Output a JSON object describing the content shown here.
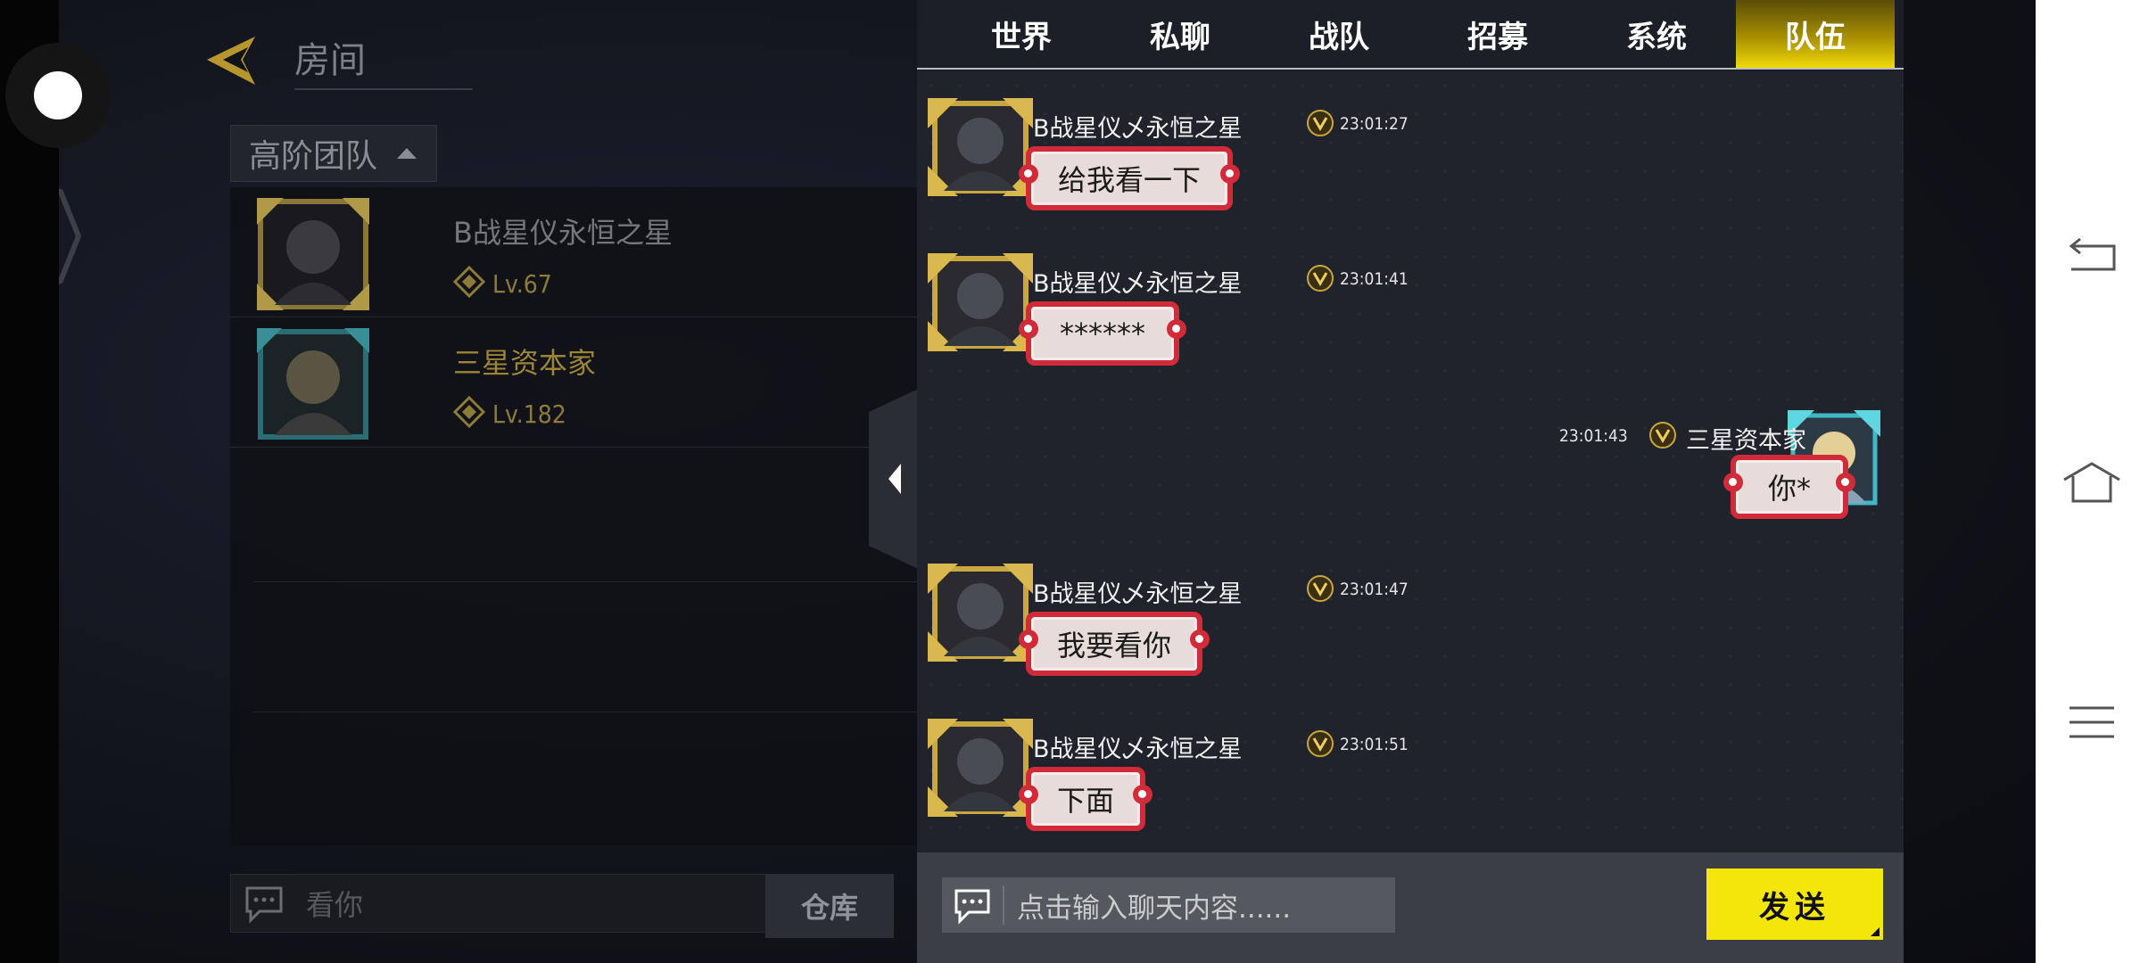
{
  "room": {
    "title": "房间",
    "team_tab": "高阶团队",
    "members": [
      {
        "name": "B战星仪永恒之星",
        "level": "Lv.67"
      },
      {
        "name": "三星资本家",
        "level": "Lv.182"
      }
    ],
    "input_text": "看你",
    "warehouse_label": "仓库"
  },
  "chat": {
    "tabs": [
      {
        "label": "世界",
        "active": false
      },
      {
        "label": "私聊",
        "active": false
      },
      {
        "label": "战队",
        "active": false
      },
      {
        "label": "招募",
        "active": false
      },
      {
        "label": "系统",
        "active": false
      },
      {
        "label": "队伍",
        "active": true
      }
    ],
    "messages": [
      {
        "sender": "B战星仪乄永恒之星",
        "time": "23:01:27",
        "text": "给我看一下",
        "side": "left"
      },
      {
        "sender": "B战星仪乄永恒之星",
        "time": "23:01:41",
        "text": "******",
        "side": "left"
      },
      {
        "sender": "三星资本家",
        "time": "23:01:43",
        "text": "你*",
        "side": "right"
      },
      {
        "sender": "B战星仪乄永恒之星",
        "time": "23:01:47",
        "text": "我要看你",
        "side": "left"
      },
      {
        "sender": "B战星仪乄永恒之星",
        "time": "23:01:51",
        "text": "下面",
        "side": "left"
      }
    ],
    "input_placeholder": "点击输入聊天内容......",
    "send_label": "发送"
  },
  "colors": {
    "accent_yellow": "#f5e60a",
    "bubble_border": "#d12b3a",
    "panel_bg": "#1c1f27"
  },
  "icons": [
    "back-arrow-icon",
    "chat-bubble-icon",
    "rank-badge-icon",
    "level-badge-icon",
    "collapse-arrow-icon",
    "nav-back-icon",
    "nav-home-icon",
    "nav-menu-icon"
  ]
}
